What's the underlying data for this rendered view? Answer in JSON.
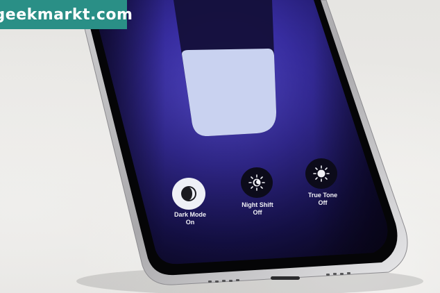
{
  "watermark": {
    "text": "geekmarkt.com"
  },
  "controls": [
    {
      "label": "Dark Mode",
      "state": "On",
      "icon": "dark-mode-icon",
      "active": true
    },
    {
      "label": "Night Shift",
      "state": "Off",
      "icon": "night-shift-icon",
      "active": false
    },
    {
      "label": "True Tone",
      "state": "Off",
      "icon": "true-tone-icon",
      "active": false
    }
  ],
  "brightness": {
    "level": 0.62
  },
  "colors": {
    "screen_dark": "#0d0826",
    "screen_violet": "#3a2fa8",
    "slider_fill": "#c9d2f0",
    "slider_track": "#14103a",
    "watermark_bg": "#2a8f86"
  }
}
